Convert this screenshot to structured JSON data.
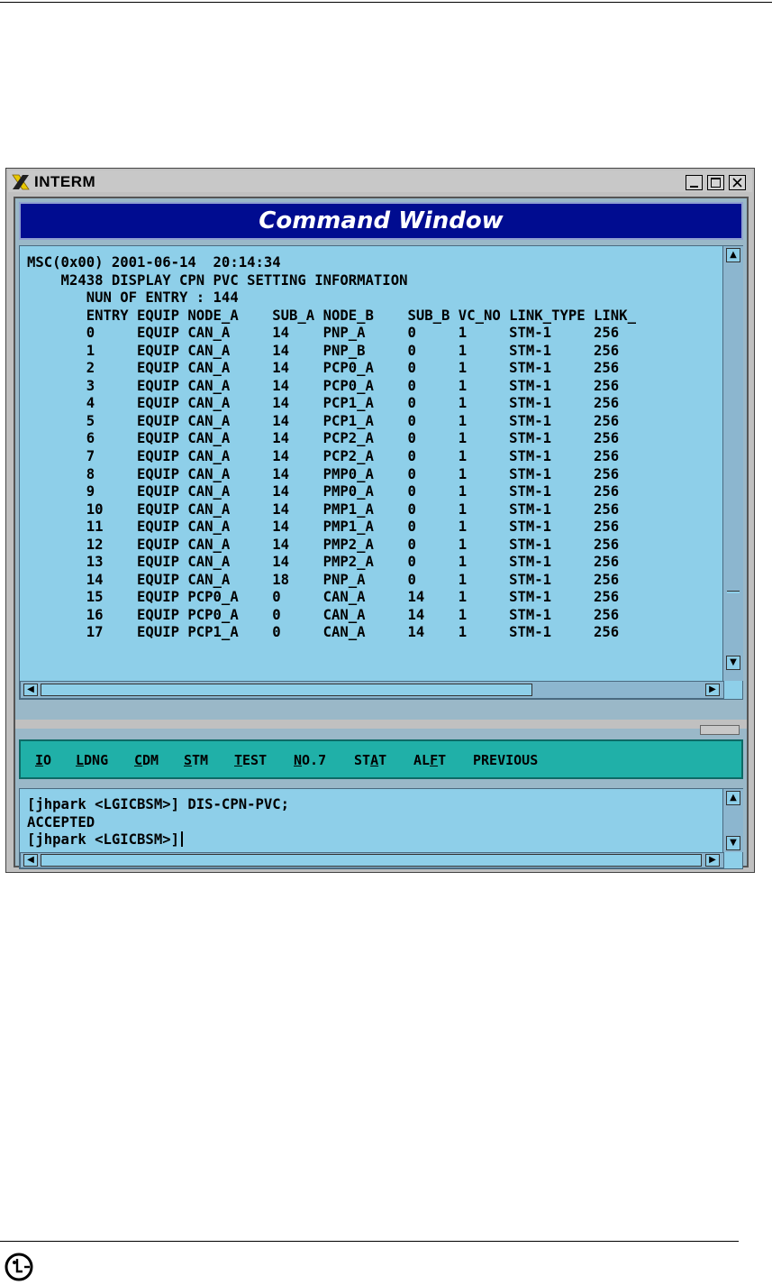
{
  "window": {
    "title": "INTERM",
    "header_title": "Command Window",
    "controls": {
      "minimize": "_",
      "maximize": "□",
      "close": "×"
    }
  },
  "output": {
    "lines": [
      "MSC(0x00) 2001-06-14  20:14:34",
      "    M2438 DISPLAY CPN PVC SETTING INFORMATION",
      "       NUN OF ENTRY : 144",
      "       ENTRY EQUIP NODE_A    SUB_A NODE_B    SUB_B VC_NO LINK_TYPE LINK_",
      "       0     EQUIP CAN_A     14    PNP_A     0     1     STM-1     256",
      "       1     EQUIP CAN_A     14    PNP_B     0     1     STM-1     256",
      "       2     EQUIP CAN_A     14    PCP0_A    0     1     STM-1     256",
      "       3     EQUIP CAN_A     14    PCP0_A    0     1     STM-1     256",
      "       4     EQUIP CAN_A     14    PCP1_A    0     1     STM-1     256",
      "       5     EQUIP CAN_A     14    PCP1_A    0     1     STM-1     256",
      "       6     EQUIP CAN_A     14    PCP2_A    0     1     STM-1     256",
      "       7     EQUIP CAN_A     14    PCP2_A    0     1     STM-1     256",
      "       8     EQUIP CAN_A     14    PMP0_A    0     1     STM-1     256",
      "       9     EQUIP CAN_A     14    PMP0_A    0     1     STM-1     256",
      "       10    EQUIP CAN_A     14    PMP1_A    0     1     STM-1     256",
      "       11    EQUIP CAN_A     14    PMP1_A    0     1     STM-1     256",
      "       12    EQUIP CAN_A     14    PMP2_A    0     1     STM-1     256",
      "       13    EQUIP CAN_A     14    PMP2_A    0     1     STM-1     256",
      "       14    EQUIP CAN_A     18    PNP_A     0     1     STM-1     256",
      "       15    EQUIP PCP0_A    0     CAN_A     14    1     STM-1     256",
      "       16    EQUIP PCP0_A    0     CAN_A     14    1     STM-1     256",
      "       17    EQUIP PCP1_A    0     CAN_A     14    1     STM-1     256"
    ]
  },
  "menu": [
    {
      "key": "I",
      "rest": "O",
      "pre": ""
    },
    {
      "key": "L",
      "rest": "DNG",
      "pre": ""
    },
    {
      "key": "C",
      "rest": "DM",
      "pre": ""
    },
    {
      "key": "S",
      "rest": "TM",
      "pre": ""
    },
    {
      "key": "T",
      "rest": "EST",
      "pre": ""
    },
    {
      "key": "N",
      "rest": "O.7",
      "pre": ""
    },
    {
      "key": "A",
      "rest": "T",
      "pre": "ST"
    },
    {
      "key": "F",
      "rest": "T",
      "pre": "AL"
    },
    {
      "key": "",
      "rest": "PREVIOUS",
      "pre": ""
    }
  ],
  "input": {
    "line1": "[jhpark <LGICBSM>] DIS-CPN-PVC;",
    "line2": "ACCEPTED",
    "line3": "[jhpark <LGICBSM>]"
  },
  "colors": {
    "header_bg": "#000c90",
    "panel_bg": "#8ecfe9",
    "menubar_bg": "#20b0a8"
  }
}
